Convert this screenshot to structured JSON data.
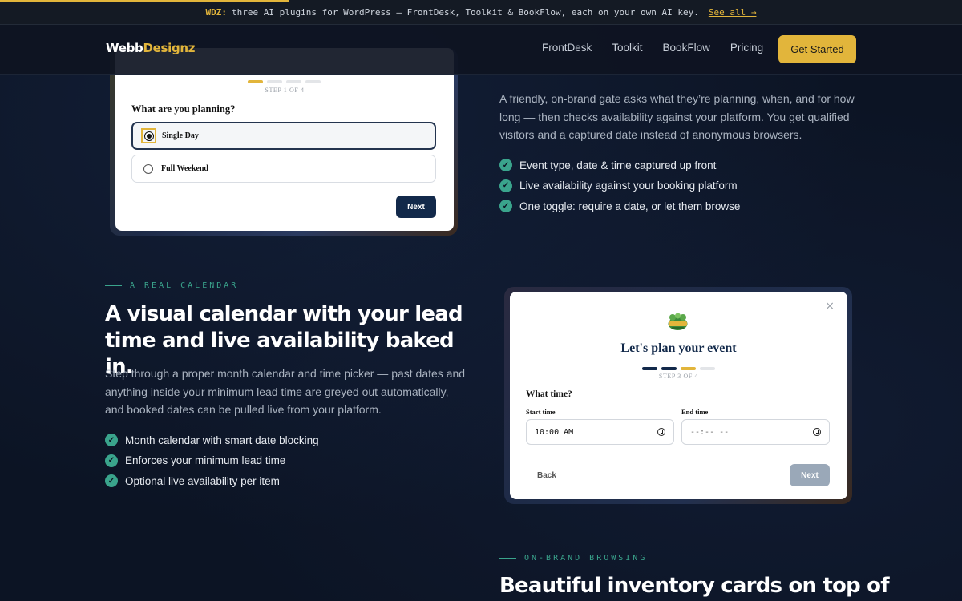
{
  "announcement": {
    "tag": "WDZ:",
    "text": "three AI plugins for WordPress — FrontDesk, Toolkit & BookFlow, each on your own AI key.",
    "link": "See all →",
    "progress": 0.3
  },
  "nav": {
    "logo_main": "Webb",
    "logo_accent": "Designz",
    "links": [
      "FrontDesk",
      "Toolkit",
      "BookFlow",
      "Pricing"
    ],
    "cta": "Get Started"
  },
  "colors": {
    "accent": "#e2b53b",
    "teal": "#3aa48c",
    "navy": "#12294a",
    "background": "#0c1424"
  },
  "card1": {
    "step_label": "STEP 1 OF 4",
    "question": "What are you planning?",
    "options": [
      "Single Day",
      "Full Weekend"
    ],
    "selected": "Single Day",
    "next": "Next"
  },
  "section1": {
    "paragraph": "A friendly, on-brand gate asks what they’re planning, when, and for how long — then checks availability against your platform. You get qualified visitors and a captured date instead of anonymous browsers.",
    "checks": [
      "Event type, date & time captured up front",
      "Live availability against your booking platform",
      "One toggle: require a date, or let them browse"
    ]
  },
  "section2": {
    "eyebrow": "A REAL CALENDAR",
    "heading": "A visual calendar with your lead time and live availability baked in.",
    "paragraph": "Step through a proper month calendar and time picker — past dates and anything inside your minimum lead time are greyed out automatically, and booked dates can be pulled live from your platform.",
    "checks": [
      "Month calendar with smart date blocking",
      "Enforces your minimum lead time",
      "Optional live availability per item"
    ]
  },
  "card2": {
    "close": "×",
    "title": "Let's plan your event",
    "step_label": "STEP 3 OF 4",
    "question": "What time?",
    "start_label": "Start time",
    "start_value": "10:00 AM",
    "end_label": "End time",
    "end_value": "--:-- --",
    "back": "Back",
    "next": "Next"
  },
  "section3": {
    "eyebrow": "ON-BRAND BROWSING",
    "heading": "Beautiful inventory cards on top of"
  }
}
